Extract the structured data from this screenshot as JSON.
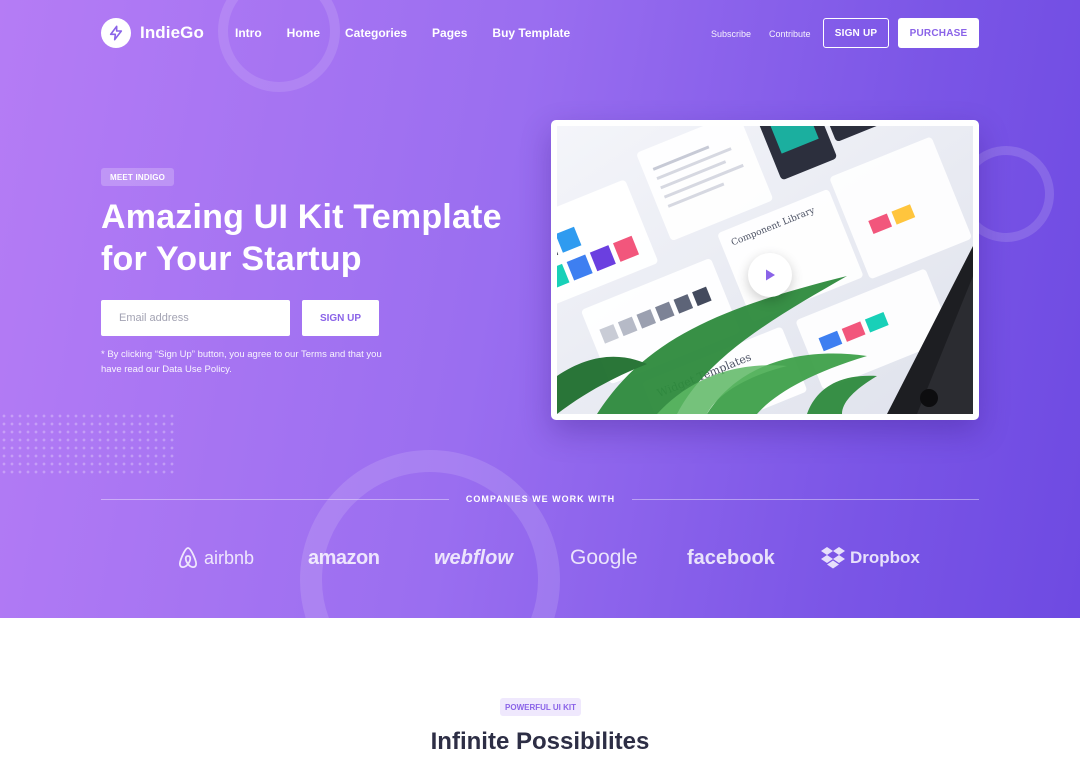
{
  "colors": {
    "accent": "#8a63e8",
    "gradient_start": "#b57cf5",
    "gradient_end": "#6e4ae2",
    "title_dark": "#2d2e45"
  },
  "brand": {
    "name": "IndieGo",
    "icon": "lightning-icon"
  },
  "nav": {
    "items": [
      "Intro",
      "Home",
      "Categories",
      "Pages",
      "Buy Template"
    ],
    "secondary": [
      "Subscribe",
      "Contribute"
    ],
    "signup_label": "SIGN UP",
    "purchase_label": "PURCHASE"
  },
  "hero": {
    "badge": "MEET INDIGO",
    "title_line1": "Amazing UI Kit Template",
    "title_line2": "for Your Startup",
    "email_placeholder": "Email address",
    "signup_label": "SIGN UP",
    "disclaimer": "* By clicking “Sign Up” button, you agree to our Terms and that you have read our Data Use Policy."
  },
  "video": {
    "play_icon": "play-icon",
    "screen_labels": [
      "Widget Templates",
      "Component Library"
    ]
  },
  "companies": {
    "heading": "COMPANIES WE WORK WITH",
    "logos": [
      "airbnb",
      "amazon",
      "webflow",
      "Google",
      "facebook",
      "Dropbox"
    ]
  },
  "section": {
    "badge": "POWERFUL UI KIT",
    "title": "Infinite Possibilites"
  }
}
